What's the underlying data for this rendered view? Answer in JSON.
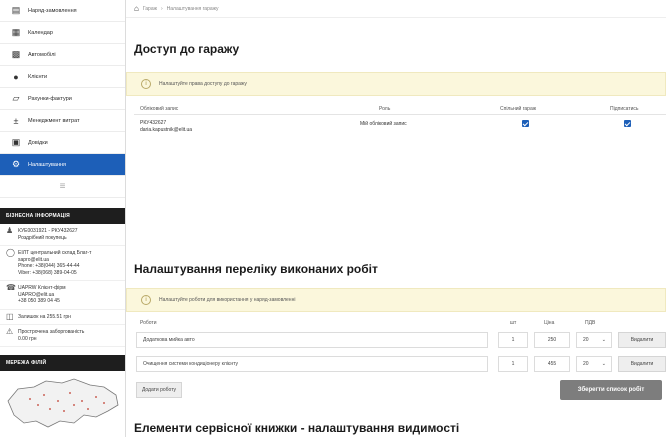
{
  "sidebar": {
    "nav": [
      {
        "icon": "clipboard-icon",
        "label": "Наряд-замовлення",
        "active": false
      },
      {
        "icon": "calendar-icon",
        "label": "Календар",
        "active": false
      },
      {
        "icon": "car-icon",
        "label": "Автомобілі",
        "active": false
      },
      {
        "icon": "users-icon",
        "label": "Клієнти",
        "active": false
      },
      {
        "icon": "invoice-icon",
        "label": "Рахунки-фактури",
        "active": false
      },
      {
        "icon": "price-icon",
        "label": "Менеджмент витрат",
        "active": false
      },
      {
        "icon": "reports-icon",
        "label": "Довідки",
        "active": false
      },
      {
        "icon": "gear-icon",
        "label": "Налаштування",
        "active": true
      }
    ],
    "info_title": "БІЗНЕСНА ІНФОРМАЦІЯ",
    "info": {
      "account": [
        "КУЕ0031921 - РКУ432627",
        "Роздрібний покупець"
      ],
      "warehouse": [
        "ЕІЛТ центральний склад Благ-т",
        "sapro@elit.ua",
        "Phone: +38(044) 365-44-44",
        "Viber: +38(068) 389-04-05"
      ],
      "manager": [
        "UAPRW Клієнт-фірм",
        "UAPRO@elit.ua",
        "+38 050 389 04 45"
      ],
      "credit": "Залишок на 255.51 грн",
      "overdue": [
        "Прострочена заборгованість",
        "0.00 грн"
      ]
    },
    "map_title": "МЕРЕЖА ФІЛІЙ"
  },
  "breadcrumb": {
    "root": "Гараж",
    "current": "Налаштування гаражу"
  },
  "garage_access": {
    "title": "Доступ до гаражу",
    "alert": "Налаштуйте права доступу до гаражу",
    "columns": [
      "Обліковий запис",
      "Роль",
      "Спільний гараж",
      "Підписатись"
    ],
    "rows": [
      {
        "account": "РКУ432627",
        "email": "daria.kapustnik@elit.ua",
        "role": "Мій обліковий запис",
        "shared": true,
        "subscribe": true
      }
    ]
  },
  "works": {
    "title": "Налаштування переліку виконаних робіт",
    "alert": "Налаштуйте роботи для використання у наряд-замовленні",
    "columns": [
      "Роботи",
      "шт",
      "Ціна",
      "ПДВ"
    ],
    "rows": [
      {
        "name": "Додаткова мийка авто",
        "qty": "1",
        "price": "250",
        "vat": "20",
        "delete": "Видалити"
      },
      {
        "name": "Очищення системи кондиціонеру клієнту",
        "qty": "1",
        "price": "455",
        "vat": "20",
        "delete": "Видалити"
      }
    ],
    "add_label": "Додати роботу",
    "save_label": "Зберегти список робіт"
  },
  "service_book": {
    "title": "Елементи сервісної книжки - налаштування видимості"
  },
  "colors": {
    "accent": "#1d5fb8",
    "alert_bg": "#fbf7dc",
    "dark_head": "#1e1e1e"
  }
}
